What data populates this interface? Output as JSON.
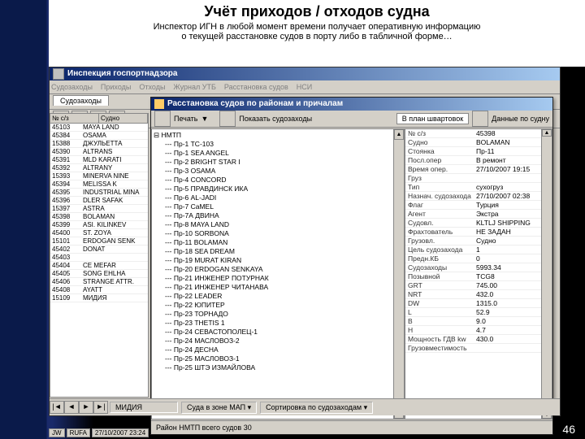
{
  "slide": {
    "title": "Учёт приходов / отходов судна",
    "subtitle1": "Инспектор ИГН в любой момент времени получает оперативную информацию",
    "subtitle2": "о текущей расстановке судов в порту либо в табличной форме…",
    "page_number": "46"
  },
  "app": {
    "title": "Инспекция госпортнадзора",
    "menu": [
      "Судозаходы",
      "Приходы",
      "Отходы",
      "Журнал УТБ",
      "Расстановка судов",
      "НСИ"
    ],
    "active_tab": "Судозаходы",
    "left_table": {
      "headers": [
        "№ с/з",
        "Судно"
      ],
      "rows": [
        [
          "45103",
          "MAYA LAND"
        ],
        [
          "45384",
          "OSAMA"
        ],
        [
          "15388",
          "ДЖУЛЬЕТТА"
        ],
        [
          "45390",
          "ALTRANS"
        ],
        [
          "45391",
          "MLD KARATI"
        ],
        [
          "45392",
          "ALTRANY"
        ],
        [
          "15393",
          "MINERVA NINE"
        ],
        [
          "45394",
          "MELISSA K"
        ],
        [
          "45395",
          "INDUSTRIAL MINA"
        ],
        [
          "45396",
          "DLER SAFAK"
        ],
        [
          "15397",
          "ASTRA"
        ],
        [
          "45398",
          "BOLAMAN"
        ],
        [
          "45399",
          "ASI. KILINKEV"
        ],
        [
          "45400",
          "ST. ZOYA"
        ],
        [
          "15101",
          "ERDOGAN SENK"
        ],
        [
          "45402",
          "DONAT"
        ],
        [
          "45403",
          ""
        ],
        [
          "45404",
          "CE MEFAR"
        ],
        [
          "45405",
          "SONG EHLHA"
        ],
        [
          "45406",
          "STRANGE ATTR."
        ],
        [
          "45408",
          "AYATT"
        ],
        [
          "15109",
          "МИДИЯ"
        ]
      ]
    },
    "status": {
      "nav_prev": "◄",
      "nav_next": "►",
      "cell1": "МИДИЯ",
      "cell2_label": "Суда в зоне МАП",
      "cell3_label": "Сортировка по судозаходам",
      "jw": "JW",
      "rufa": "RUFA",
      "date": "27/10/2007 23:24"
    }
  },
  "child": {
    "title": "Расстановка судов по районам и причалам",
    "toolbar": {
      "print": "Печать",
      "show_label": "Показать судозаходы",
      "plan": "В план швартовок",
      "data": "Данные по судну"
    },
    "tree_root": "НМТП",
    "tree": [
      "--- Пр-1  ТС-103",
      "--- Пр-1  SEA ANGEL",
      "--- Пр-2  BRIGHT STAR I",
      "--- Пр-3  OSAMA",
      "--- Пр-4  CONCORD",
      "--- Пр-5  ПРАВДИНСК ИКА",
      "--- Пр-6  AL-JADI",
      "--- Пр-7  CaMEL",
      "--- Пр-7А  ДВИНА",
      "--- Пр-8  MAYA LAND",
      "--- Пр-10  SORBONA",
      "--- Пр-11  BOLAMAN",
      "--- Пр-18  SEA DREAM",
      "--- Пр-19  MURAT KIRAN",
      "--- Пр-20  ERDOGAN SENKAYA",
      "--- Пр-21  ИНЖЕНЕР ПОТУРНАК",
      "--- Пр-21  ИНЖЕНЕР ЧИТАНАВА",
      "--- Пр-22  LEADER",
      "--- Пр-22  ЮПИТЕР",
      "--- Пр-23  ТОРНАДО",
      "--- Пр-23  THETIS 1",
      "--- Пр-24  СЕВАСТОПОЛЕЦ-1",
      "--- Пр-24  МАСЛОВОЗ-2",
      "--- Пр-24  ДЕСНА",
      "--- Пр-25  МАСЛОВОЗ-1",
      "--- Пр-25  ШТЭ ИЗМАЙЛОВА"
    ],
    "props_header": [
      "",
      ""
    ],
    "props": [
      [
        "№ с/з",
        "45398"
      ],
      [
        "Судно",
        "BOLAMAN"
      ],
      [
        "Стоянка",
        "Пр-11"
      ],
      [
        "Посл.опер",
        "В ремонт"
      ],
      [
        "Время опер.",
        "27/10/2007 19:15"
      ],
      [
        "Груз",
        ""
      ],
      [
        "Тип",
        "сухогруз"
      ],
      [
        "Назнач. судозахода",
        "27/10/2007 02:38"
      ],
      [
        "Флаг",
        "Турция"
      ],
      [
        "Агент",
        "Экстра"
      ],
      [
        "Судовл.",
        "KLTLJ SHIPPING"
      ],
      [
        "Фрахтователь",
        "НЕ ЗАДАН"
      ],
      [
        "Грузовл.",
        "Судно"
      ],
      [
        "Цель судозахода",
        "1"
      ],
      [
        "Предн.КБ",
        "0"
      ],
      [
        "Судозаходы",
        "5993.34"
      ],
      [
        "Позывной",
        "TCG8"
      ],
      [
        "GRT",
        "745.00"
      ],
      [
        "NRT",
        "432.0"
      ],
      [
        "DW",
        "1315.0"
      ],
      [
        "L",
        "52.9"
      ],
      [
        "B",
        "9.0"
      ],
      [
        "H",
        "4.7"
      ],
      [
        "Мощность ГДВ kw",
        "430.0"
      ],
      [
        "Грузовместимость",
        ""
      ]
    ],
    "status": "Район НМТП всего судов 30"
  }
}
